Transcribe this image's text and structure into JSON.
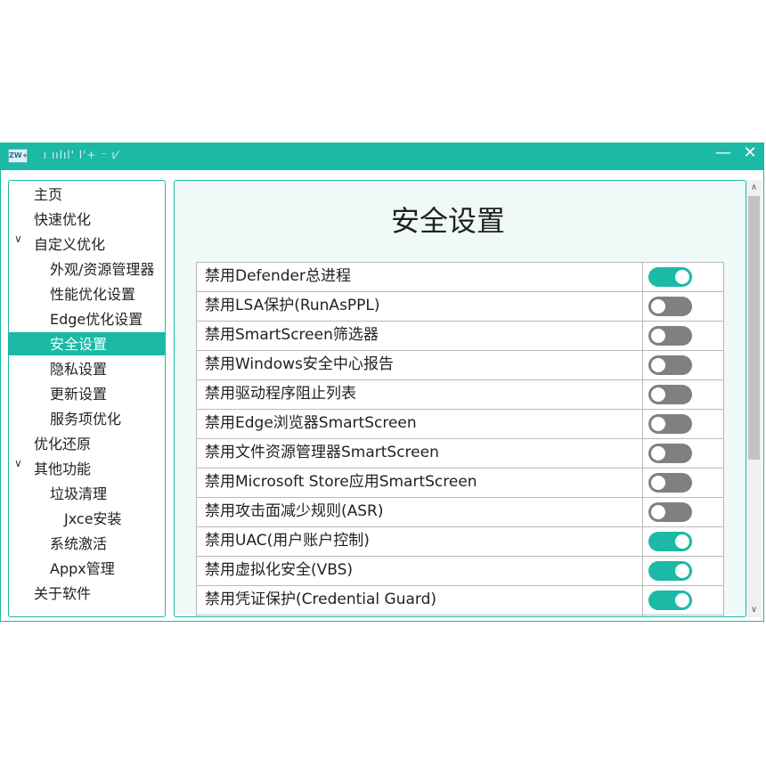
{
  "window": {
    "icon_text": "ZW+",
    "title": "⠀ı ıılıl' l'+ ⁻ ı⁄",
    "minimize_glyph": "—",
    "close_glyph": "✕"
  },
  "sidebar": {
    "items": [
      {
        "label": "主页",
        "expanded": null,
        "selected": false
      },
      {
        "label": "快速优化",
        "expanded": null,
        "selected": false
      },
      {
        "label": "自定义优化",
        "expanded": true,
        "selected": false
      },
      {
        "label": "外观/资源管理器",
        "expanded": null,
        "selected": false
      },
      {
        "label": "性能优化设置",
        "expanded": null,
        "selected": false
      },
      {
        "label": "Edge优化设置",
        "expanded": null,
        "selected": false
      },
      {
        "label": "安全设置",
        "expanded": null,
        "selected": true
      },
      {
        "label": "隐私设置",
        "expanded": null,
        "selected": false
      },
      {
        "label": "更新设置",
        "expanded": null,
        "selected": false
      },
      {
        "label": "服务项优化",
        "expanded": null,
        "selected": false
      },
      {
        "label": "优化还原",
        "expanded": null,
        "selected": false
      },
      {
        "label": "其他功能",
        "expanded": true,
        "selected": false
      },
      {
        "label": "垃圾清理",
        "expanded": null,
        "selected": false
      },
      {
        "label": "Jxce安装",
        "expanded": null,
        "selected": false
      },
      {
        "label": "系统激活",
        "expanded": null,
        "selected": false
      },
      {
        "label": "Appx管理",
        "expanded": null,
        "selected": false
      },
      {
        "label": "关于软件",
        "expanded": null,
        "selected": false
      }
    ],
    "chevron_glyph": "∨"
  },
  "main": {
    "title": "安全设置",
    "settings": [
      {
        "label": "禁用Defender总进程",
        "enabled": true
      },
      {
        "label": "禁用LSA保护(RunAsPPL)",
        "enabled": false
      },
      {
        "label": "禁用SmartScreen筛选器",
        "enabled": false
      },
      {
        "label": "禁用Windows安全中心报告",
        "enabled": false
      },
      {
        "label": "禁用驱动程序阻止列表",
        "enabled": false
      },
      {
        "label": "禁用Edge浏览器SmartScreen",
        "enabled": false
      },
      {
        "label": "禁用文件资源管理器SmartScreen",
        "enabled": false
      },
      {
        "label": "禁用Microsoft Store应用SmartScreen",
        "enabled": false
      },
      {
        "label": "禁用攻击面减少规则(ASR)",
        "enabled": false
      },
      {
        "label": "禁用UAC(用户账户控制)",
        "enabled": true
      },
      {
        "label": "禁用虚拟化安全(VBS)",
        "enabled": true
      },
      {
        "label": "禁用凭证保护(Credential Guard)",
        "enabled": true
      },
      {
        "label": "",
        "enabled": false
      }
    ]
  },
  "scrollbar": {
    "up_glyph": "∧",
    "down_glyph": "∨"
  },
  "colors": {
    "accent": "#1bb9a6",
    "toggle_off": "#808080",
    "content_bg": "#eef9f8"
  }
}
